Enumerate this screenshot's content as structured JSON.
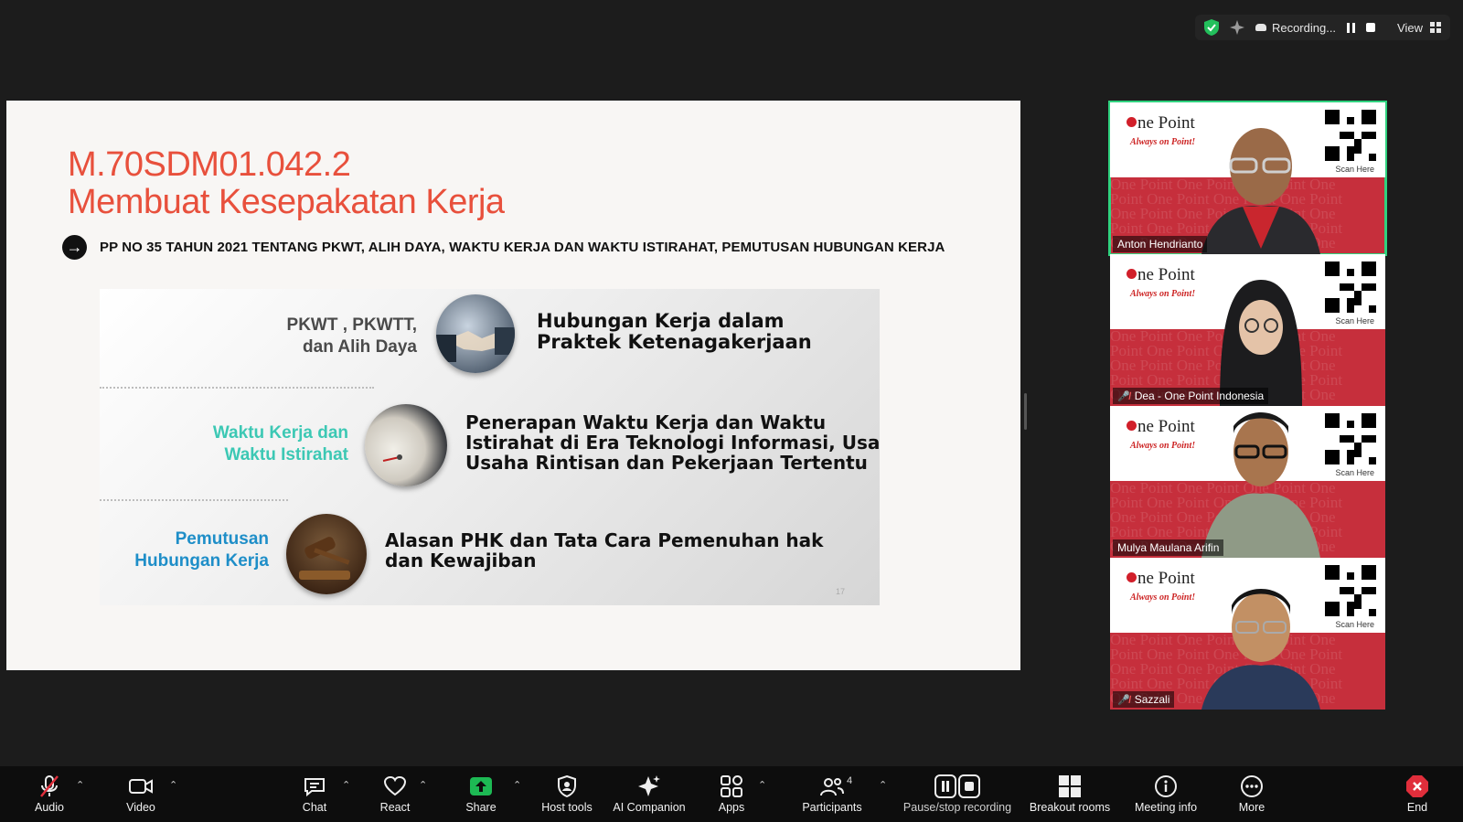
{
  "status_bar": {
    "recording_label": "Recording...",
    "view_label": "View"
  },
  "slide": {
    "title_line1": "M.70SDM01.042.2",
    "title_line2": "Membuat Kesepakatan Kerja",
    "subtitle": "PP NO 35 TAHUN 2021 TENTANG PKWT, ALIH DAYA, WAKTU  KERJA DAN WAKTU ISTIRAHAT, PEMUTUSAN HUBUNGAN KERJA",
    "rows": [
      {
        "left_line1": "PKWT , PKWTT,",
        "left_line2": "dan Alih Daya",
        "right_line1": "Hubungan Kerja dalam",
        "right_line2": "Praktek Ketenagakerjaan",
        "right_line3": "",
        "left_color": "#4a4a4a"
      },
      {
        "left_line1": "Waktu Kerja dan",
        "left_line2": "Waktu Istirahat",
        "right_line1": "Penerapan Waktu Kerja dan Waktu",
        "right_line2": "Istirahat di Era Teknologi Informasi, Usaha",
        "right_line3": "Usaha Rintisan dan Pekerjaan Tertentu",
        "left_color": "#3cc8b4"
      },
      {
        "left_line1": "Pemutusan",
        "left_line2": "Hubungan Kerja",
        "right_line1": "Alasan PHK dan Tata Cara Pemenuhan hak",
        "right_line2": "dan  Kewajiban",
        "right_line3": "",
        "left_color": "#1e8ec8"
      }
    ],
    "page_number": "17"
  },
  "participants": [
    {
      "name": "Anton Hendrianto",
      "muted": false,
      "active": true
    },
    {
      "name": "Dea - One Point Indonesia",
      "muted": true,
      "active": false
    },
    {
      "name": "Mulya Maulana Arifin",
      "muted": false,
      "active": false
    },
    {
      "name": "Sazzali",
      "muted": true,
      "active": false
    }
  ],
  "tile_branding": {
    "brand": "ne Point",
    "tagline": "Always on Point!",
    "scan_label": "Scan Here"
  },
  "toolbar": {
    "audio": "Audio",
    "video": "Video",
    "chat": "Chat",
    "react": "React",
    "share": "Share",
    "host_tools": "Host tools",
    "ai_companion": "AI Companion",
    "apps": "Apps",
    "participants": "Participants",
    "participants_count": "4",
    "pause_stop": "Pause/stop recording",
    "breakout": "Breakout rooms",
    "meeting_info": "Meeting info",
    "more": "More",
    "end": "End"
  },
  "colors": {
    "title_red": "#e8503c",
    "active_border": "#2fd27e",
    "tile_red": "#c62f3c",
    "share_green": "#1db954",
    "end_red": "#e02e3b"
  }
}
